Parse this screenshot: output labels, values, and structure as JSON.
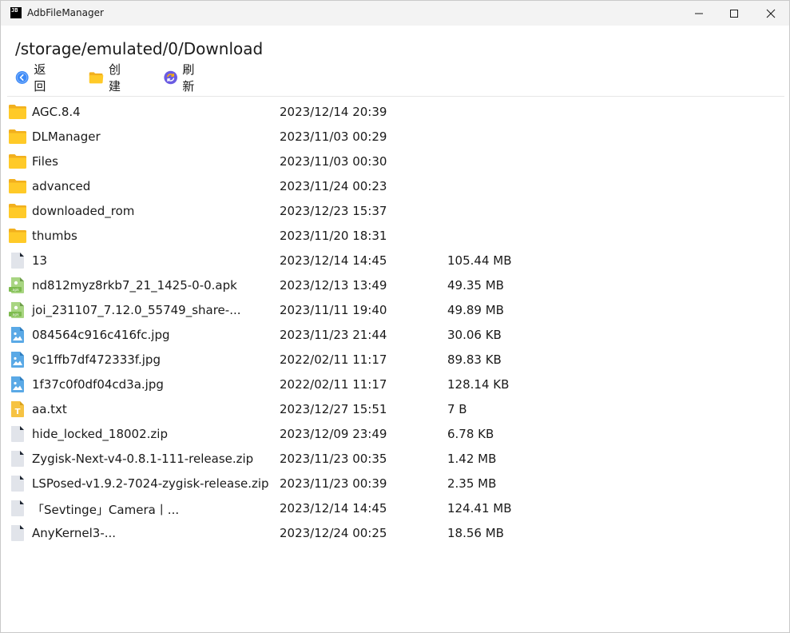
{
  "window": {
    "title": "AdbFileManager",
    "logo_text": "JB"
  },
  "path": "/storage/emulated/0/Download",
  "toolbar": {
    "back_label": "返回",
    "create_label": "创建",
    "refresh_label": "刷新"
  },
  "colors": {
    "folder": "#FFCA28",
    "file": "#E1E4EA",
    "apk": "#8BC34A",
    "image": "#5AA9E6",
    "text": "#F6C343",
    "back": "#3D8AF7",
    "refresh": "#6A5BE2"
  },
  "files": [
    {
      "name": "AGC.8.4",
      "date": "2023/12/14 20:39",
      "size": "",
      "icon": "folder-icon"
    },
    {
      "name": "DLManager",
      "date": "2023/11/03 00:29",
      "size": "",
      "icon": "folder-icon"
    },
    {
      "name": "Files",
      "date": "2023/11/03 00:30",
      "size": "",
      "icon": "folder-icon"
    },
    {
      "name": "advanced",
      "date": "2023/11/24 00:23",
      "size": "",
      "icon": "folder-icon"
    },
    {
      "name": "downloaded_rom",
      "date": "2023/12/23 15:37",
      "size": "",
      "icon": "folder-icon"
    },
    {
      "name": "thumbs",
      "date": "2023/11/20 18:31",
      "size": "",
      "icon": "folder-icon"
    },
    {
      "name": "13",
      "date": "2023/12/14 14:45",
      "size": "105.44 MB",
      "icon": "file-icon"
    },
    {
      "name": "nd812myz8rkb7_21_1425-0-0.apk",
      "date": "2023/12/13 13:49",
      "size": "49.35 MB",
      "icon": "apk-icon"
    },
    {
      "name": "joi_231107_7.12.0_55749_share-...",
      "date": "2023/11/11 19:40",
      "size": "49.89 MB",
      "icon": "apk-icon"
    },
    {
      "name": "084564c916c416fc.jpg",
      "date": "2023/11/23 21:44",
      "size": "30.06 KB",
      "icon": "image-icon"
    },
    {
      "name": "9c1ffb7df472333f.jpg",
      "date": "2022/02/11 11:17",
      "size": "89.83 KB",
      "icon": "image-icon"
    },
    {
      "name": "1f37c0f0df04cd3a.jpg",
      "date": "2022/02/11 11:17",
      "size": "128.14 KB",
      "icon": "image-icon"
    },
    {
      "name": "aa.txt",
      "date": "2023/12/27 15:51",
      "size": "7 B",
      "icon": "text-file-icon"
    },
    {
      "name": "hide_locked_18002.zip",
      "date": "2023/12/09 23:49",
      "size": "6.78 KB",
      "icon": "file-icon"
    },
    {
      "name": "Zygisk-Next-v4-0.8.1-111-release.zip",
      "date": "2023/11/23 00:35",
      "size": "1.42 MB",
      "icon": "file-icon"
    },
    {
      "name": "LSPosed-v1.9.2-7024-zygisk-release.zip",
      "date": "2023/11/23 00:39",
      "size": "2.35 MB",
      "icon": "file-icon"
    },
    {
      "name": "「Sevtinge」Camera丨...",
      "date": "2023/12/14 14:45",
      "size": "124.41 MB",
      "icon": "file-icon"
    },
    {
      "name": "AnyKernel3-...",
      "date": "2023/12/24 00:25",
      "size": "18.56 MB",
      "icon": "file-icon"
    }
  ]
}
